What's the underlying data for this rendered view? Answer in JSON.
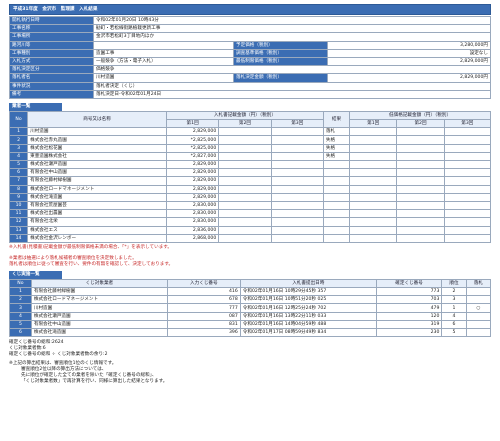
{
  "title": "平成31年度　金沢市　監理課　入札結果",
  "info": {
    "r1": {
      "label": "開札執行日時",
      "value": "令和02年01月20日 10時43分"
    },
    "r2": {
      "label": "工事名称",
      "value": "勧町・若松線街路植栽更新工事"
    },
    "r3": {
      "label": "工事場所",
      "value": "金沢市若松町3丁目地内ほか"
    },
    "r4": {
      "label": "路河川等",
      "value": "",
      "label2": "予定価格（税別）",
      "value2": "3,280,000円"
    },
    "r5": {
      "label": "工事種別",
      "value": "造園工事",
      "label2": "調査基準価格（税別）",
      "value2": "設定なし"
    },
    "r6": {
      "label": "入札方式",
      "value": "一般競争（方法・電子入札）",
      "label2": "最低制限価格（税別）",
      "value2": "2,829,000円"
    },
    "r7": {
      "label": "落札決定区分",
      "value": "価格競争"
    },
    "r8": {
      "label": "落札者名",
      "value": "川村造園",
      "label2": "落札決定金額（税別）",
      "value2": "2,829,000円"
    },
    "r9": {
      "label": "事件状況",
      "value": "落札者決定（くじ）"
    },
    "r10": {
      "label": "備考",
      "value": "落札決定日-令和02年01月24日"
    }
  },
  "bidders": {
    "section_label": "業者一覧",
    "headers": {
      "no": "No",
      "name": "商号又は名称",
      "bid": "入札書記載金額（円）（税別）",
      "result": "結果",
      "low": "低価格記載金額（円）（税別）",
      "r1": "第1回",
      "r2": "第2回",
      "r3": "第3回"
    },
    "rows": [
      {
        "no": "1",
        "name": "川村造園",
        "amt": "2,829,000",
        "result": "落札"
      },
      {
        "no": "2",
        "name": "株式会社赤丸造園",
        "amt": "*2,825,000",
        "result": "失格"
      },
      {
        "no": "3",
        "name": "株式会社松花園",
        "amt": "*2,825,000",
        "result": "失格"
      },
      {
        "no": "4",
        "name": "東豊造園株式会社",
        "amt": "*2,827,000",
        "result": "失格"
      },
      {
        "no": "5",
        "name": "株式会社瀬戸造園",
        "amt": "2,829,000",
        "result": ""
      },
      {
        "no": "6",
        "name": "有限会社中山造園",
        "amt": "2,829,000",
        "result": ""
      },
      {
        "no": "7",
        "name": "有限会社藤村緑樹園",
        "amt": "2,829,000",
        "result": ""
      },
      {
        "no": "8",
        "name": "株式会社ロードマネージメント",
        "amt": "2,829,000",
        "result": ""
      },
      {
        "no": "9",
        "name": "株式会社滝造園",
        "amt": "2,829,000",
        "result": ""
      },
      {
        "no": "10",
        "name": "有限会社荒屋園芸",
        "amt": "2,830,000",
        "result": ""
      },
      {
        "no": "11",
        "name": "株式会社出農園",
        "amt": "2,830,000",
        "result": ""
      },
      {
        "no": "12",
        "name": "有限会社北栄",
        "amt": "2,830,000",
        "result": ""
      },
      {
        "no": "13",
        "name": "株式会社エス",
        "amt": "2,836,000",
        "result": ""
      },
      {
        "no": "14",
        "name": "株式会社金沢レンボー",
        "amt": "2,868,000",
        "result": ""
      }
    ],
    "note_red": "※入札書(見積書)記載金額が最低制限価格未満の場合、「*」を表示しています。",
    "note_1": "※業者は抽選により落札候補者の審査順位を決定致しました。",
    "note_2": "落札者は順位に従って審査を行い、要件の有無を確認して、決定しております。"
  },
  "lottery": {
    "section_label": "くじ実施一覧",
    "headers": {
      "no": "No",
      "name": "くじ対象業者",
      "lot": "入力くじ番号",
      "time": "入札書提出日時",
      "confirmed": "確定くじ番号",
      "rank": "順位",
      "win": "落札"
    },
    "rows": [
      {
        "no": "1",
        "name": "有限会社藤村緑樹園",
        "lot": "416",
        "time": "令和02年01月16日 10時29分45秒 357",
        "confirmed": "773",
        "rank": "2",
        "win": ""
      },
      {
        "no": "2",
        "name": "株式会社ロードマネージメント",
        "lot": "678",
        "time": "令和02年01月16日 10時51分20秒 025",
        "confirmed": "703",
        "rank": "3",
        "win": ""
      },
      {
        "no": "3",
        "name": "川村造園",
        "lot": "777",
        "time": "令和02年01月16日 12時25分24秒 702",
        "confirmed": "479",
        "rank": "1",
        "win": "○"
      },
      {
        "no": "4",
        "name": "株式会社瀬戸造園",
        "lot": "087",
        "time": "令和02年01月16日 13時22分11秒 033",
        "confirmed": "120",
        "rank": "4",
        "win": ""
      },
      {
        "no": "5",
        "name": "有限会社中山造園",
        "lot": "831",
        "time": "令和02年01月16日 14時04分59秒 488",
        "confirmed": "319",
        "rank": "6",
        "win": ""
      },
      {
        "no": "6",
        "name": "株式会社滝造園",
        "lot": "396",
        "time": "令和02年01月17日 08時59分49秒 834",
        "confirmed": "230",
        "rank": "5",
        "win": ""
      }
    ],
    "sum_line": "確定くじ番号の総和:2624",
    "count_line": "くじ対象業者数:6",
    "remainder_line": "確定くじ番号の総和 ÷ くじ対象業者数の余り:2",
    "note_a": "※上記の算出結果は、審査順位1位のくじ情報です。",
    "note_b": "審査順位2位以降の算出方法については、",
    "note_c": "先に順位が確定した全ての業者を除いた「確定くじ番号の総和」、",
    "note_d": "「くじ対象業者数」で再計算を行い、同様に算出した結果となります。"
  }
}
